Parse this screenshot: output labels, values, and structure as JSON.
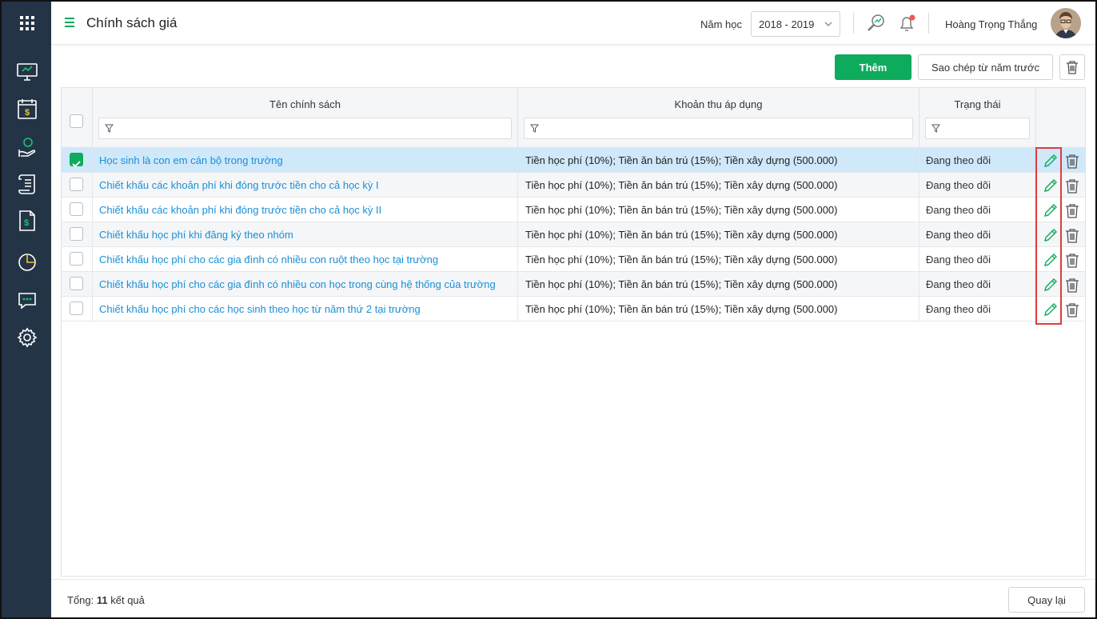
{
  "header": {
    "title": "Chính sách giá",
    "year_label": "Năm học",
    "year_value": "2018 - 2019",
    "user_name": "Hoàng Trọng Thắng"
  },
  "toolbar": {
    "add_label": "Thêm",
    "copy_label": "Sao chép từ năm trước"
  },
  "table": {
    "columns": [
      "Tên chính sách",
      "Khoản thu áp dụng",
      "Trạng thái"
    ],
    "rows": [
      {
        "name": "Học sinh là con em cán bộ trong trường",
        "fees": "Tiền học phí (10%); Tiền ăn bán trú (15%); Tiền xây dựng (500.000)",
        "status": "Đang theo dõi",
        "checked": true
      },
      {
        "name": "Chiết khấu các khoản phí khi đóng trước tiền cho cả học kỳ I",
        "fees": "Tiền học phí (10%); Tiền ăn bán trú (15%); Tiền xây dựng (500.000)",
        "status": "Đang theo dõi",
        "checked": false
      },
      {
        "name": "Chiết khấu các khoản phí khi đóng trước tiền cho cả học kỳ II",
        "fees": "Tiền học phí (10%); Tiền ăn bán trú (15%); Tiền xây dựng (500.000)",
        "status": "Đang theo dõi",
        "checked": false
      },
      {
        "name": "Chiết khấu học phí khi đăng ký theo nhóm",
        "fees": "Tiền học phí (10%); Tiền ăn bán trú (15%); Tiền xây dựng (500.000)",
        "status": "Đang theo dõi",
        "checked": false
      },
      {
        "name": "Chiết khấu học phí cho các gia đình có nhiều con ruột theo học tại trường",
        "fees": "Tiền học phí (10%); Tiền ăn bán trú (15%); Tiền xây dựng (500.000)",
        "status": "Đang theo dõi",
        "checked": false
      },
      {
        "name": "Chiết khấu học phí cho các gia đình có nhiều con học trong cùng hệ thống của trường",
        "fees": "Tiền học phí (10%); Tiền ăn bán trú (15%); Tiền xây dựng (500.000)",
        "status": "Đang theo dõi",
        "checked": false
      },
      {
        "name": "Chiết khấu học phí cho các học sinh theo học từ năm thứ 2 tại trường",
        "fees": "Tiền học phí (10%); Tiền ăn bán trú (15%); Tiền xây dựng (500.000)",
        "status": "Đang theo dõi",
        "checked": false
      }
    ]
  },
  "footer": {
    "total_prefix": "Tổng:",
    "total_count": "11",
    "total_suffix": "kết quả",
    "back_label": "Quay lại"
  },
  "sidebar": {
    "items": [
      "monitor-icon",
      "calendar-dollar-icon",
      "hand-coin-icon",
      "scroll-icon",
      "invoice-icon",
      "pie-chart-icon",
      "chat-icon",
      "settings-icon"
    ]
  },
  "colors": {
    "sidebar_bg": "#243447",
    "accent_green": "#0eab5c",
    "link_blue": "#1a8fd6",
    "selected_row": "#cfe8fa",
    "highlight_red": "#e03b3b"
  }
}
